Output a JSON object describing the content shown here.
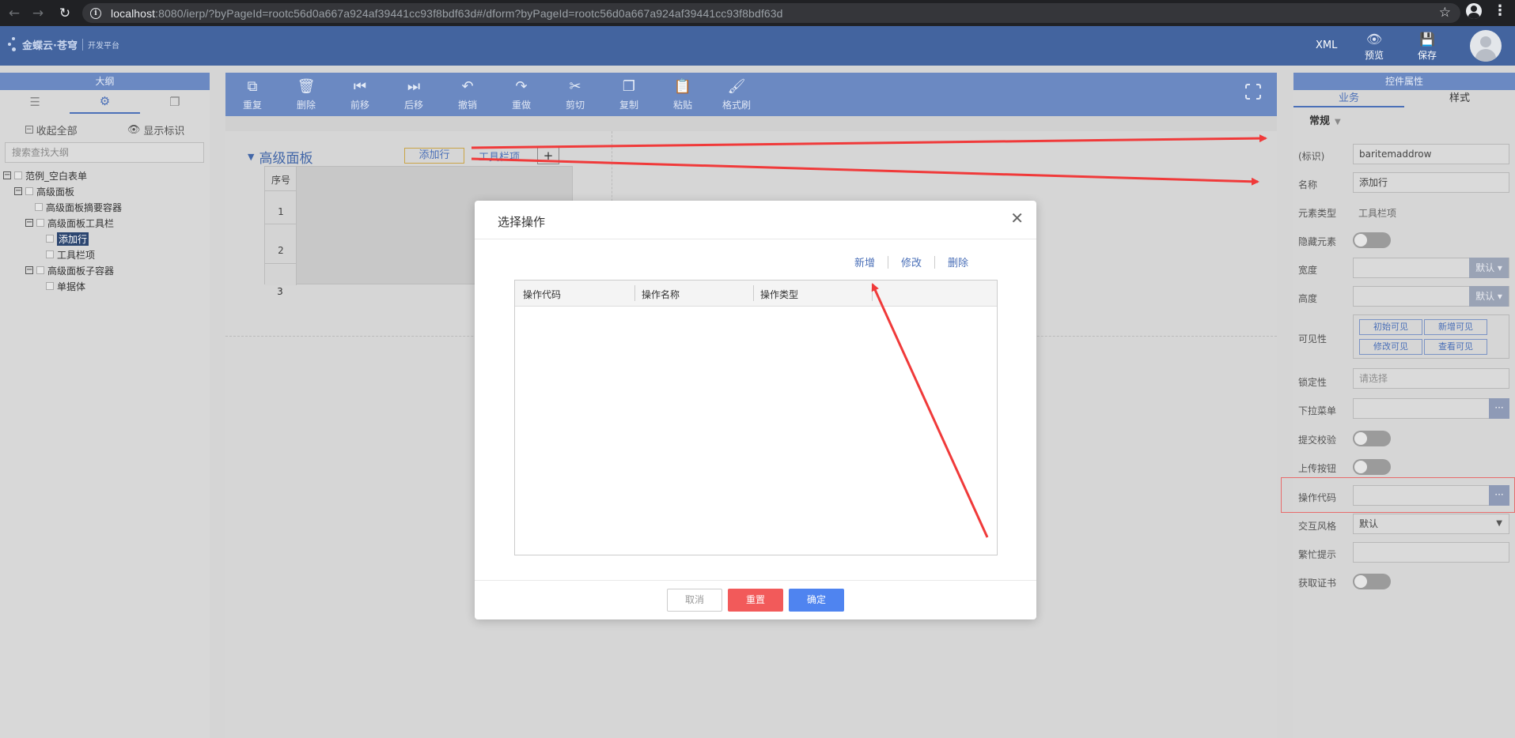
{
  "browser": {
    "url_host": "localhost",
    "url_rest": ":8080/ierp/?byPageId=rootc56d0a667a924af39441cc93f8bdf63d#/dform?byPageId=rootc56d0a667a924af39441cc93f8bdf63d"
  },
  "header": {
    "logo_text": "金蝶云·苍穹",
    "logo_sub": "开发平台",
    "xml": "XML",
    "preview": "预览",
    "save": "保存"
  },
  "outline": {
    "title": "大纲",
    "collapse_all": "收起全部",
    "show_marks": "显示标识",
    "search_placeholder": "搜索查找大纲",
    "tree": [
      {
        "label": "范例_空白表单"
      },
      {
        "label": "高级面板"
      },
      {
        "label": "高级面板摘要容器"
      },
      {
        "label": "高级面板工具栏"
      },
      {
        "label": "添加行"
      },
      {
        "label": "工具栏项"
      },
      {
        "label": "高级面板子容器"
      },
      {
        "label": "单据体"
      }
    ]
  },
  "toolbar": {
    "redo": "重复",
    "delete": "删除",
    "move_prev": "前移",
    "move_next": "后移",
    "undo": "撤销",
    "redo2": "重做",
    "cut": "剪切",
    "copy": "复制",
    "paste": "粘贴",
    "format_brush": "格式刷"
  },
  "canvas": {
    "panel_title": "高级面板",
    "add_row": "添加行",
    "toolbar_item": "工具栏项",
    "plus": "+",
    "grid_header": "序号",
    "rows": [
      "1",
      "2",
      "3"
    ]
  },
  "props": {
    "title": "控件属性",
    "tab_business": "业务",
    "tab_style": "样式",
    "section": "常规",
    "key_label": "(标识)",
    "key_value": "baritemaddrow",
    "name_label": "名称",
    "name_value": "添加行",
    "type_label": "元素类型",
    "type_value": "工具栏项",
    "hidden_label": "隐藏元素",
    "width_label": "宽度",
    "height_label": "高度",
    "unit_default": "默认",
    "visibility_label": "可见性",
    "vis_initial": "初始可见",
    "vis_new": "新增可见",
    "vis_edit": "修改可见",
    "vis_view": "查看可见",
    "lock_label": "锁定性",
    "lock_placeholder": "请选择",
    "dropdown_label": "下拉菜单",
    "submit_check_label": "提交校验",
    "upload_btn_label": "上传按钮",
    "op_code_label": "操作代码",
    "interact_label": "交互风格",
    "interact_value": "默认",
    "busy_label": "繁忙提示",
    "cert_label": "获取证书",
    "dots": "···"
  },
  "modal": {
    "title": "选择操作",
    "add": "新增",
    "edit": "修改",
    "delete": "删除",
    "columns": [
      "操作代码",
      "操作名称",
      "操作类型"
    ],
    "cancel": "取消",
    "reset": "重置",
    "ok": "确定"
  },
  "colors": {
    "header_blue": "#43649f",
    "accent": "#4b70b8",
    "annotation_red": "#f03a3a",
    "reset_red": "#f25a5a",
    "ok_blue": "#4f84f0"
  }
}
